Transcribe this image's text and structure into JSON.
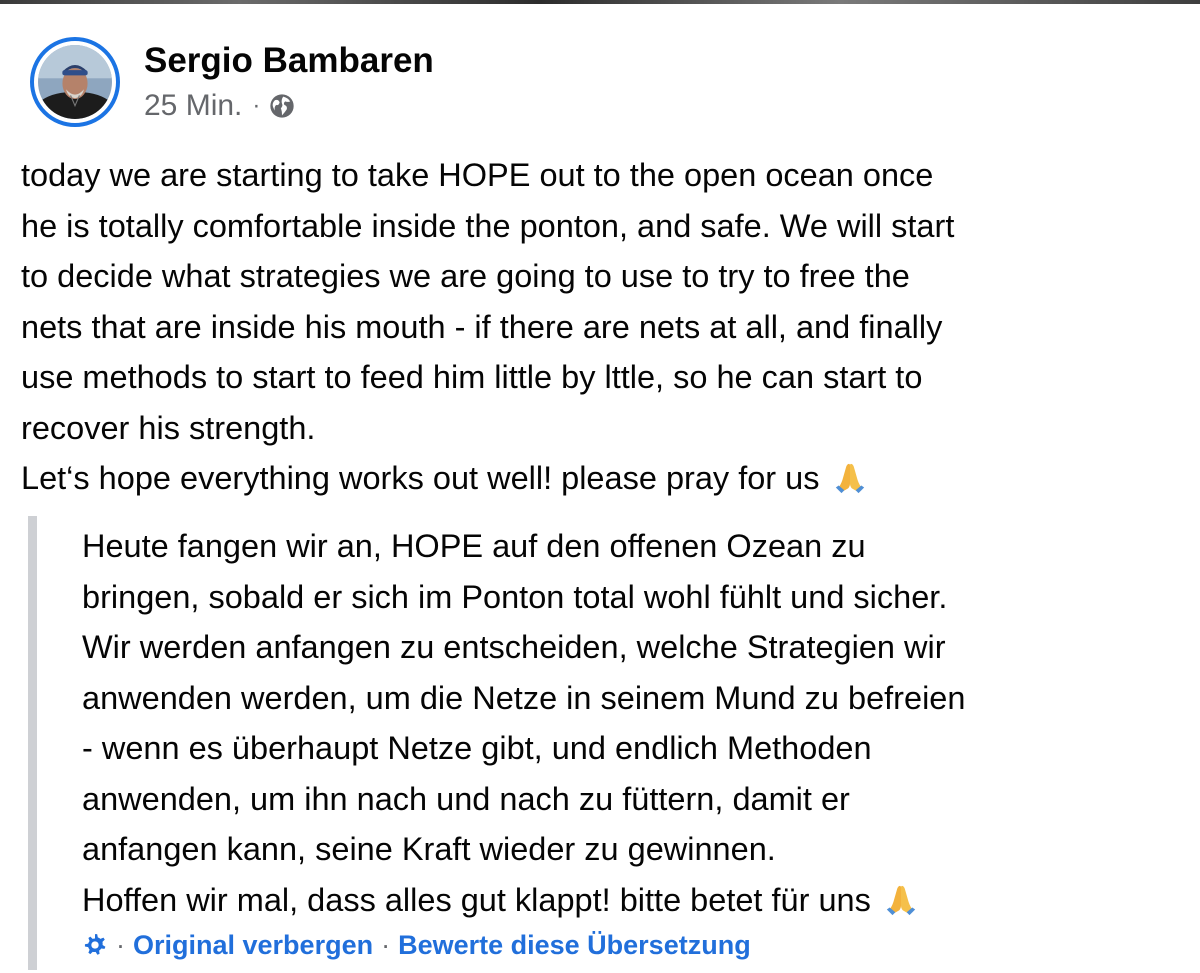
{
  "post": {
    "author": "Sergio Bambaren",
    "time": "25 Min.",
    "separator": "·",
    "privacy_icon": "globe-icon",
    "text_lines": [
      "today we are starting to take HOPE out to the open ocean once",
      "he is totally comfortable inside the ponton, and safe. We will start",
      "to decide what strategies we are going to use to try to free the",
      "nets that are inside his mouth - if there are nets at all, and finally",
      "use methods to start to feed him little by lttle, so he can start to",
      "recover his strength.",
      "Let‘s hope everything works out well! please pray for us"
    ],
    "text_emoji": "folded-hands-emoji"
  },
  "translation": {
    "lines": [
      "Heute fangen wir an, HOPE auf den offenen Ozean zu",
      "bringen, sobald er sich im Ponton total wohl fühlt und sicher.",
      "Wir werden anfangen zu entscheiden, welche Strategien wir",
      "anwenden werden, um die Netze in seinem Mund zu befreien",
      "- wenn es überhaupt Netze gibt, und endlich Methoden",
      "anwenden, um ihn nach und nach zu füttern, damit er",
      "anfangen kann, seine Kraft wieder zu gewinnen.",
      "Hoffen wir mal, dass alles gut klappt! bitte betet für uns"
    ],
    "emoji": "folded-hands-emoji",
    "settings_icon": "gear-icon",
    "hide_original_label": "Original verbergen",
    "rate_label": "Bewerte diese Übersetzung",
    "separator": "·"
  },
  "colors": {
    "accent": "#1b74e4",
    "link": "#216fdb",
    "secondary_text": "#65676b",
    "quote_bar": "#ced0d4"
  }
}
